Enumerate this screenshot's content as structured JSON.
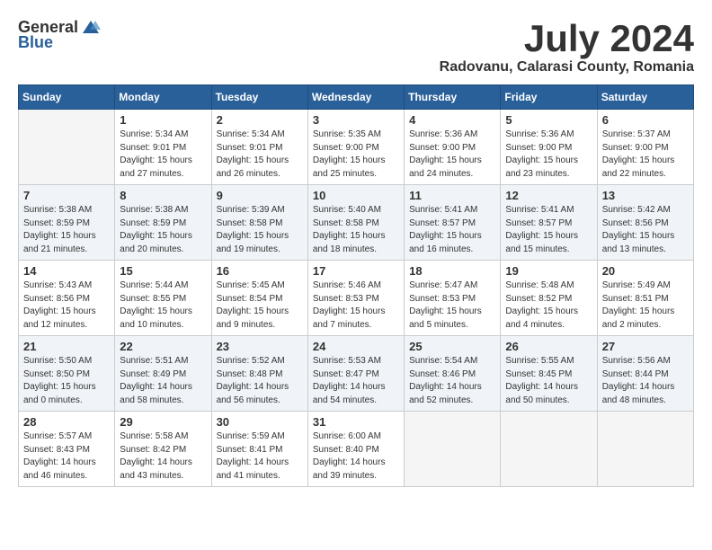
{
  "header": {
    "logo_general": "General",
    "logo_blue": "Blue",
    "month_title": "July 2024",
    "subtitle": "Radovanu, Calarasi County, Romania"
  },
  "days_of_week": [
    "Sunday",
    "Monday",
    "Tuesday",
    "Wednesday",
    "Thursday",
    "Friday",
    "Saturday"
  ],
  "weeks": [
    [
      {
        "day": "",
        "info": ""
      },
      {
        "day": "1",
        "info": "Sunrise: 5:34 AM\nSunset: 9:01 PM\nDaylight: 15 hours\nand 27 minutes."
      },
      {
        "day": "2",
        "info": "Sunrise: 5:34 AM\nSunset: 9:01 PM\nDaylight: 15 hours\nand 26 minutes."
      },
      {
        "day": "3",
        "info": "Sunrise: 5:35 AM\nSunset: 9:00 PM\nDaylight: 15 hours\nand 25 minutes."
      },
      {
        "day": "4",
        "info": "Sunrise: 5:36 AM\nSunset: 9:00 PM\nDaylight: 15 hours\nand 24 minutes."
      },
      {
        "day": "5",
        "info": "Sunrise: 5:36 AM\nSunset: 9:00 PM\nDaylight: 15 hours\nand 23 minutes."
      },
      {
        "day": "6",
        "info": "Sunrise: 5:37 AM\nSunset: 9:00 PM\nDaylight: 15 hours\nand 22 minutes."
      }
    ],
    [
      {
        "day": "7",
        "info": "Sunrise: 5:38 AM\nSunset: 8:59 PM\nDaylight: 15 hours\nand 21 minutes."
      },
      {
        "day": "8",
        "info": "Sunrise: 5:38 AM\nSunset: 8:59 PM\nDaylight: 15 hours\nand 20 minutes."
      },
      {
        "day": "9",
        "info": "Sunrise: 5:39 AM\nSunset: 8:58 PM\nDaylight: 15 hours\nand 19 minutes."
      },
      {
        "day": "10",
        "info": "Sunrise: 5:40 AM\nSunset: 8:58 PM\nDaylight: 15 hours\nand 18 minutes."
      },
      {
        "day": "11",
        "info": "Sunrise: 5:41 AM\nSunset: 8:57 PM\nDaylight: 15 hours\nand 16 minutes."
      },
      {
        "day": "12",
        "info": "Sunrise: 5:41 AM\nSunset: 8:57 PM\nDaylight: 15 hours\nand 15 minutes."
      },
      {
        "day": "13",
        "info": "Sunrise: 5:42 AM\nSunset: 8:56 PM\nDaylight: 15 hours\nand 13 minutes."
      }
    ],
    [
      {
        "day": "14",
        "info": "Sunrise: 5:43 AM\nSunset: 8:56 PM\nDaylight: 15 hours\nand 12 minutes."
      },
      {
        "day": "15",
        "info": "Sunrise: 5:44 AM\nSunset: 8:55 PM\nDaylight: 15 hours\nand 10 minutes."
      },
      {
        "day": "16",
        "info": "Sunrise: 5:45 AM\nSunset: 8:54 PM\nDaylight: 15 hours\nand 9 minutes."
      },
      {
        "day": "17",
        "info": "Sunrise: 5:46 AM\nSunset: 8:53 PM\nDaylight: 15 hours\nand 7 minutes."
      },
      {
        "day": "18",
        "info": "Sunrise: 5:47 AM\nSunset: 8:53 PM\nDaylight: 15 hours\nand 5 minutes."
      },
      {
        "day": "19",
        "info": "Sunrise: 5:48 AM\nSunset: 8:52 PM\nDaylight: 15 hours\nand 4 minutes."
      },
      {
        "day": "20",
        "info": "Sunrise: 5:49 AM\nSunset: 8:51 PM\nDaylight: 15 hours\nand 2 minutes."
      }
    ],
    [
      {
        "day": "21",
        "info": "Sunrise: 5:50 AM\nSunset: 8:50 PM\nDaylight: 15 hours\nand 0 minutes."
      },
      {
        "day": "22",
        "info": "Sunrise: 5:51 AM\nSunset: 8:49 PM\nDaylight: 14 hours\nand 58 minutes."
      },
      {
        "day": "23",
        "info": "Sunrise: 5:52 AM\nSunset: 8:48 PM\nDaylight: 14 hours\nand 56 minutes."
      },
      {
        "day": "24",
        "info": "Sunrise: 5:53 AM\nSunset: 8:47 PM\nDaylight: 14 hours\nand 54 minutes."
      },
      {
        "day": "25",
        "info": "Sunrise: 5:54 AM\nSunset: 8:46 PM\nDaylight: 14 hours\nand 52 minutes."
      },
      {
        "day": "26",
        "info": "Sunrise: 5:55 AM\nSunset: 8:45 PM\nDaylight: 14 hours\nand 50 minutes."
      },
      {
        "day": "27",
        "info": "Sunrise: 5:56 AM\nSunset: 8:44 PM\nDaylight: 14 hours\nand 48 minutes."
      }
    ],
    [
      {
        "day": "28",
        "info": "Sunrise: 5:57 AM\nSunset: 8:43 PM\nDaylight: 14 hours\nand 46 minutes."
      },
      {
        "day": "29",
        "info": "Sunrise: 5:58 AM\nSunset: 8:42 PM\nDaylight: 14 hours\nand 43 minutes."
      },
      {
        "day": "30",
        "info": "Sunrise: 5:59 AM\nSunset: 8:41 PM\nDaylight: 14 hours\nand 41 minutes."
      },
      {
        "day": "31",
        "info": "Sunrise: 6:00 AM\nSunset: 8:40 PM\nDaylight: 14 hours\nand 39 minutes."
      },
      {
        "day": "",
        "info": ""
      },
      {
        "day": "",
        "info": ""
      },
      {
        "day": "",
        "info": ""
      }
    ]
  ]
}
